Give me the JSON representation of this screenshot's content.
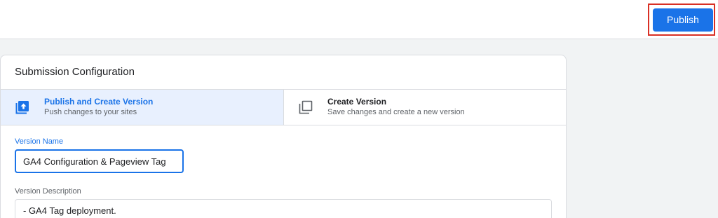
{
  "toolbar": {
    "publish_label": "Publish"
  },
  "submission": {
    "title": "Submission Configuration",
    "options": [
      {
        "title": "Publish and Create Version",
        "subtitle": "Push changes to your sites",
        "icon": "publish-upload-icon",
        "selected": true
      },
      {
        "title": "Create Version",
        "subtitle": "Save changes and create a new version",
        "icon": "create-version-icon",
        "selected": false
      }
    ],
    "version_name": {
      "label": "Version Name",
      "value": "GA4 Configuration & Pageview Tag"
    },
    "version_description": {
      "label": "Version Description",
      "value": "- GA4 Tag deployment."
    }
  },
  "colors": {
    "accent": "#1a73e8",
    "selected_bg": "#e8f0fe",
    "highlight": "#d93025",
    "background": "#f1f3f4"
  }
}
